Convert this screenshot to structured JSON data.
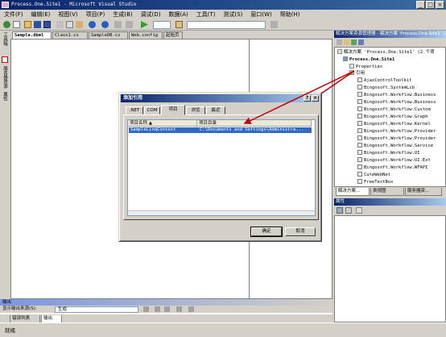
{
  "window": {
    "title": "Process.One.Site1 - Microsoft Visual Studio",
    "min": "_",
    "max": "□",
    "close": "×"
  },
  "menu": [
    "文件(F)",
    "编辑(E)",
    "视图(V)",
    "项目(P)",
    "生成(B)",
    "调试(D)",
    "数据(A)",
    "工具(T)",
    "测试(S)",
    "窗口(W)",
    "帮助(H)"
  ],
  "doc_tabs": [
    "Sample.dbml",
    "Class1.cs",
    "SampleDB.cs",
    "Web.config",
    "起始页"
  ],
  "left_tabs": [
    "工具箱",
    "服务器资源管理器",
    "属性"
  ],
  "solution_explorer": {
    "title": "解决方案资源管理器 - 解决方案 'Process.One.Site1' (2 个项目)",
    "root": "解决方案 'Process.One.Site1' (2 个项",
    "project": "Process.One.Site1",
    "properties": "Properties",
    "references": "引用",
    "refs": [
      "AjaxControlToolkit",
      "Bingosoft.SystemLib",
      "Bingosoft.Workflow.Business",
      "Bingosoft.Workflow.Business",
      "Bingosoft.Workflow.Custom",
      "Bingosoft.Workflow.Graph",
      "Bingosoft.Workflow.Kernel",
      "Bingosoft.Workflow.Provider",
      "Bingosoft.Workflow.Provider",
      "Bingosoft.Workflow.Service",
      "Bingosoft.Workflow.UI",
      "Bingosoft.Workflow.UI.Ext",
      "Bingosoft.Workflow.WFAPI",
      "CuteWebNet",
      "FreeTextBox"
    ]
  },
  "right_bottom_tabs": [
    "解决方案...",
    "类视图",
    "服务器资..."
  ],
  "properties_panel": {
    "title": "属性"
  },
  "output": {
    "title": "输出",
    "show_from_label": "显示输出来源(S):",
    "show_from_value": "生成",
    "tabs": [
      "错误列表",
      "输出"
    ]
  },
  "status": "就绪",
  "dialog": {
    "title": "添加引用",
    "help": "?",
    "close": "×",
    "tabs": [
      ".NET",
      "COM",
      "项目",
      "浏览",
      "最近"
    ],
    "active_tab": "项目",
    "columns": [
      "项目名称 ▲",
      "项目目录"
    ],
    "rows": [
      {
        "name": "SampleLinqContext",
        "dir": "C:\\Documents and Settings\\Administra..."
      }
    ],
    "ok": "确定",
    "cancel": "取消"
  },
  "colors": {
    "title_bar": "#0a246a",
    "selection": "#316ac5",
    "annotation_arrow": "#c00000"
  }
}
